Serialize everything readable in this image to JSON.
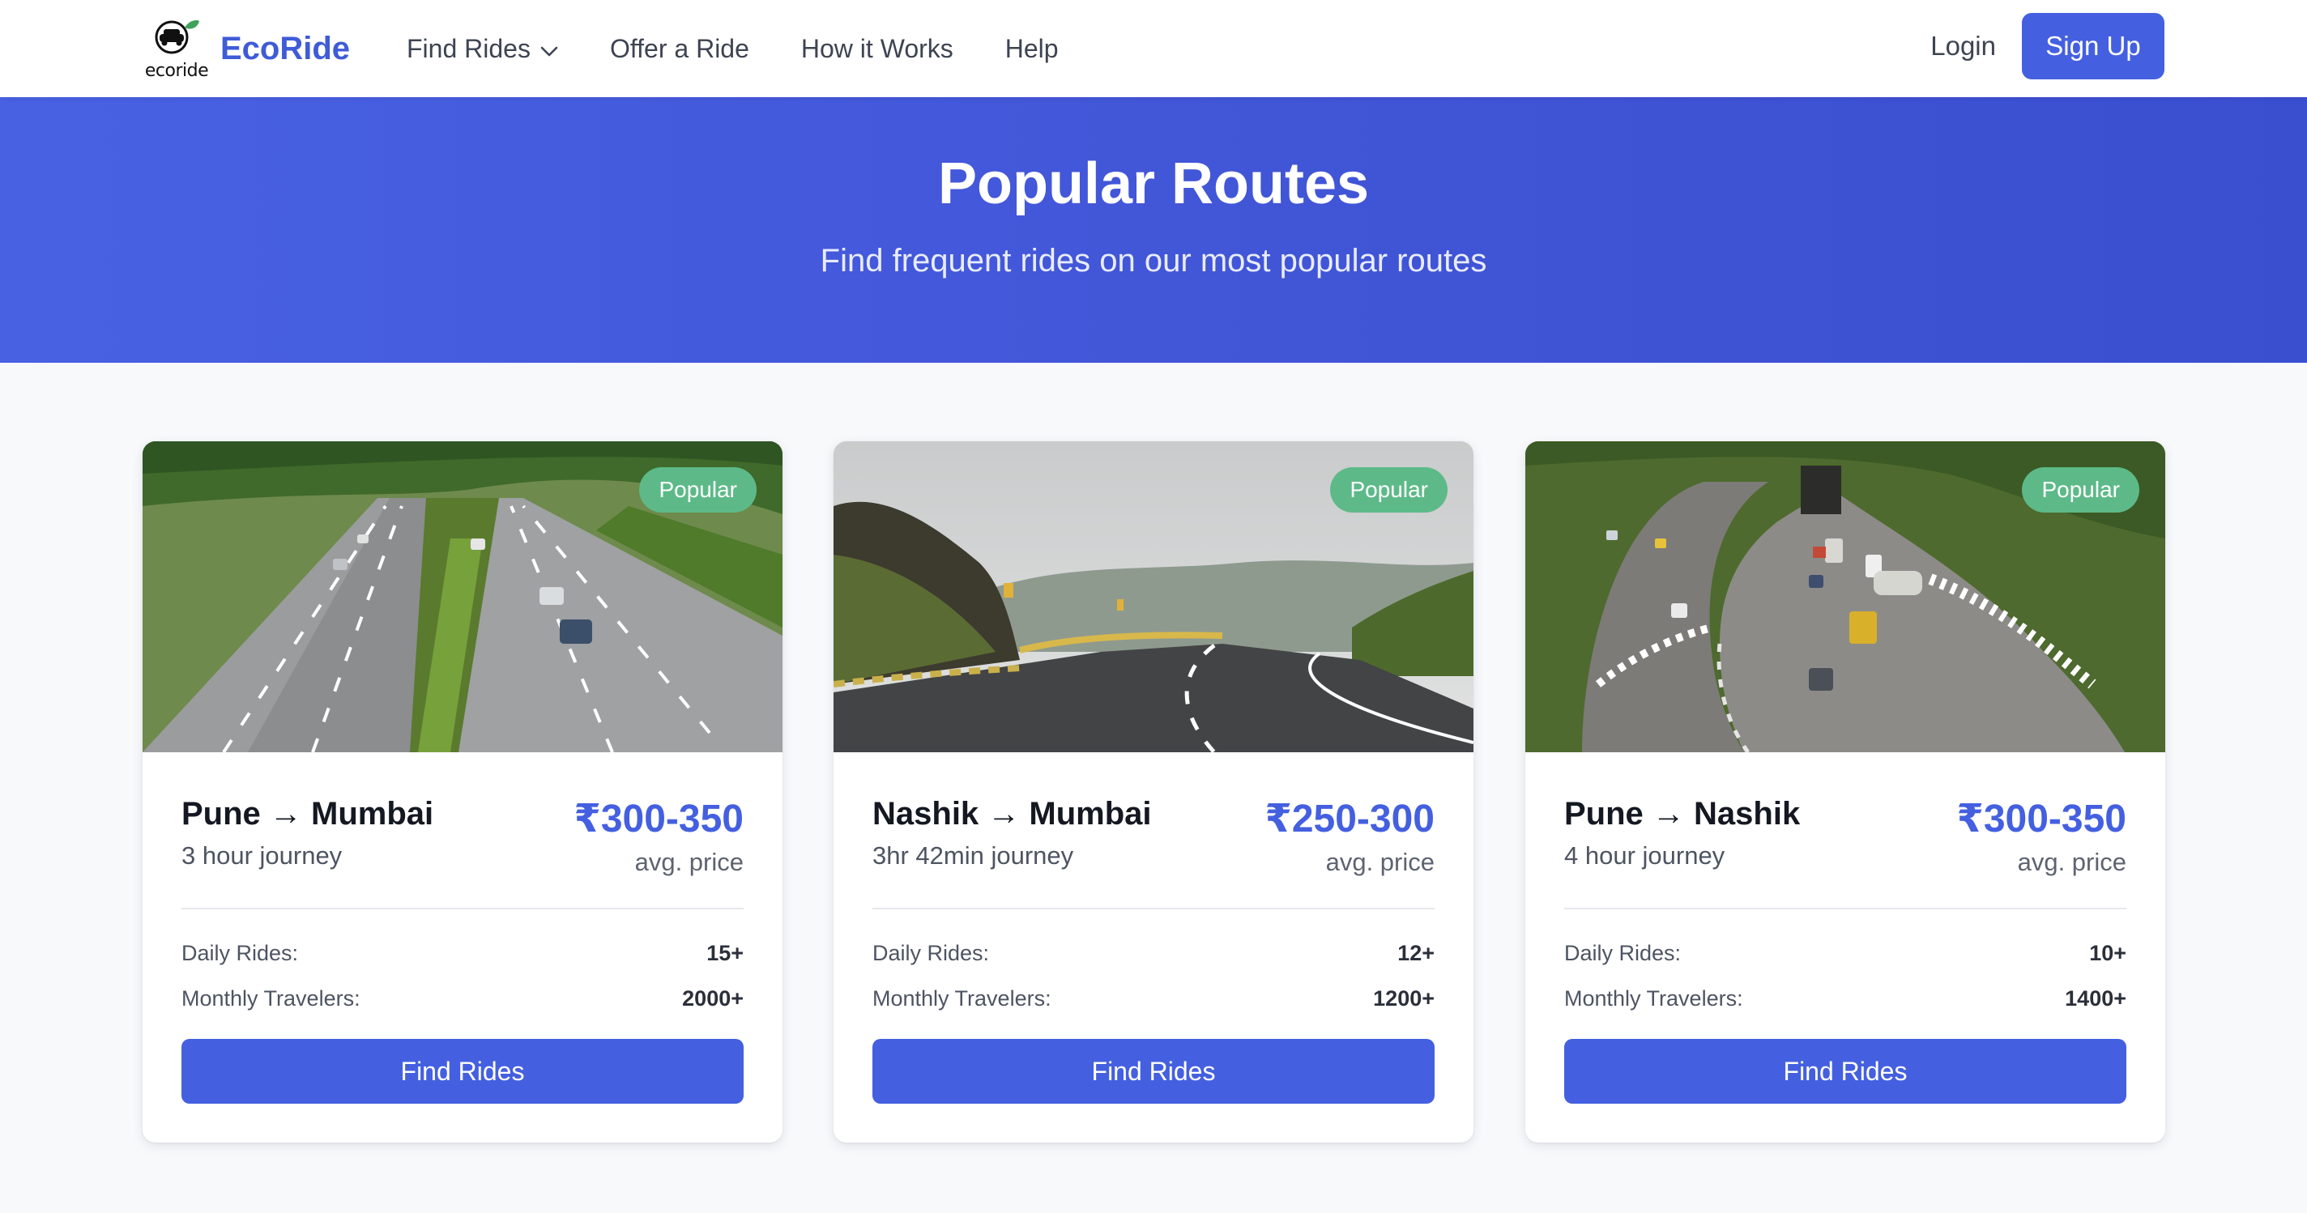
{
  "colors": {
    "primary": "#4460e0",
    "badge": "#5dba88",
    "hero": "#4258db"
  },
  "nav": {
    "logo_text": "ecoride",
    "brand": "EcoRide",
    "links": [
      "Find Rides",
      "Offer a Ride",
      "How it Works",
      "Help"
    ],
    "login": "Login",
    "signup": "Sign Up"
  },
  "hero": {
    "title": "Popular Routes",
    "subtitle": "Find frequent rides on our most popular routes"
  },
  "routes": [
    {
      "badge": "Popular",
      "title": "Pune → Mumbai",
      "duration": "3 hour journey",
      "price": "₹300-350",
      "price_note": "avg. price",
      "daily_label": "Daily Rides:",
      "daily": "15+",
      "monthly_label": "Monthly Travelers:",
      "monthly": "2000+",
      "button": "Find Rides",
      "image": "expressway-photo"
    },
    {
      "badge": "Popular",
      "title": "Nashik → Mumbai",
      "duration": "3hr 42min journey",
      "price": "₹250-300",
      "price_note": "avg. price",
      "daily_label": "Daily Rides:",
      "daily": "12+",
      "monthly_label": "Monthly Travelers:",
      "monthly": "1200+",
      "button": "Find Rides",
      "image": "ghat-road-photo"
    },
    {
      "badge": "Popular",
      "title": "Pune → Nashik",
      "duration": "4 hour journey",
      "price": "₹300-350",
      "price_note": "avg. price",
      "daily_label": "Daily Rides:",
      "daily": "10+",
      "monthly_label": "Monthly Travelers:",
      "monthly": "1400+",
      "button": "Find Rides",
      "image": "highway-curve-photo"
    }
  ]
}
